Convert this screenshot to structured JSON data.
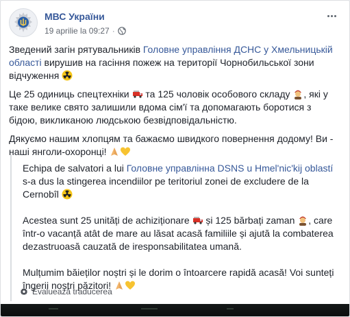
{
  "post": {
    "page_name": "МВС України",
    "date": "19 aprilie la 09:27",
    "separator": "·",
    "original": {
      "p1_before": "Зведений загін рятувальників ",
      "p1_link": "Головне управління ДСНС у Хмельницькій області",
      "p1_after": " вирушив на гасіння пожеж на території Чорнобильської зони відчуження",
      "p2_a": "Це 25 одиниць спецтехніки",
      "p2_b": "та 125 чоловік особового складу",
      "p2_c": ", які у таке велике свято залишили вдома сім'ї та допомагають боротися з бідою, викликаною людською безвідповідальністю.",
      "p3": "Дякуємо нашим хлопцям та бажаємо швидкого повернення додому! Ви - наші янголи-охоронці!"
    },
    "translation": {
      "p1_before": "Echipa de salvatori a lui ",
      "p1_link": "Головне управлінна DSNS u Hmel'nic'kij oblastí",
      "p1_after": " s-a dus la stingerea incendiilor pe teritoriul zonei de excludere de la Cernobîl",
      "p2_a": "Acestea sunt 25 unități de achiziționare",
      "p2_b": "și 125 bărbați zaman",
      "p2_c": ", care într-o vacanță atât de mare au lăsat acasă familiile și ajută la combaterea dezastruoasă cauzată de iresponsabilitatea umană.",
      "p3": "Mulțumim băieților noștri și le dorim o întoarcere rapidă acasă! Voi sunteți îngerii noștri păzitori!"
    },
    "rate_translation": "Evaluează traducerea"
  },
  "icons": [
    "police-emblem-icon",
    "globe-icon",
    "more-options-icon",
    "radioactive-icon",
    "fire-truck-icon",
    "person-icon",
    "praying-hands-icon",
    "yellow-heart-icon",
    "gear-icon"
  ],
  "colors": {
    "link": "#365899",
    "meta": "#616770",
    "text": "#1d2129"
  }
}
